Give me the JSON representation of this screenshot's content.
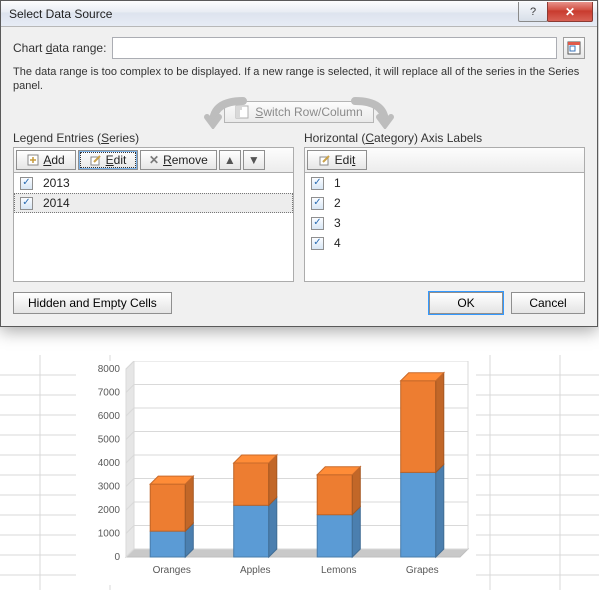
{
  "dialog": {
    "title": "Select Data Source",
    "data_range_label": "Chart data range:",
    "data_range_value": "",
    "warning_text": "The data range is too complex to be displayed. If a new range is selected, it will replace all of the series in the Series panel.",
    "switch_button": "Switch Row/Column",
    "legend_panel_title": "Legend Entries (Series)",
    "category_panel_title": "Horizontal (Category) Axis Labels",
    "buttons": {
      "add": "Add",
      "edit": "Edit",
      "remove": "Remove",
      "hidden": "Hidden and Empty Cells",
      "ok": "OK",
      "cancel": "Cancel"
    },
    "series": [
      {
        "label": "2013",
        "checked": true,
        "selected": false
      },
      {
        "label": "2014",
        "checked": true,
        "selected": true
      }
    ],
    "categories": [
      {
        "label": "1",
        "checked": true
      },
      {
        "label": "2",
        "checked": true
      },
      {
        "label": "3",
        "checked": true
      },
      {
        "label": "4",
        "checked": true
      }
    ]
  },
  "chart_data": {
    "type": "bar",
    "subtype": "stacked-3d",
    "categories": [
      "Oranges",
      "Apples",
      "Lemons",
      "Grapes"
    ],
    "series": [
      {
        "name": "2013",
        "color": "#5b9bd5",
        "values": [
          1100,
          2200,
          1800,
          3600
        ]
      },
      {
        "name": "2014",
        "color": "#ed7d31",
        "values": [
          2000,
          1800,
          1700,
          3900
        ]
      }
    ],
    "title": "",
    "xlabel": "",
    "ylabel": "",
    "ylim": [
      0,
      8000
    ],
    "ytick_step": 1000,
    "yticks": [
      0,
      1000,
      2000,
      3000,
      4000,
      5000,
      6000,
      7000,
      8000
    ]
  }
}
